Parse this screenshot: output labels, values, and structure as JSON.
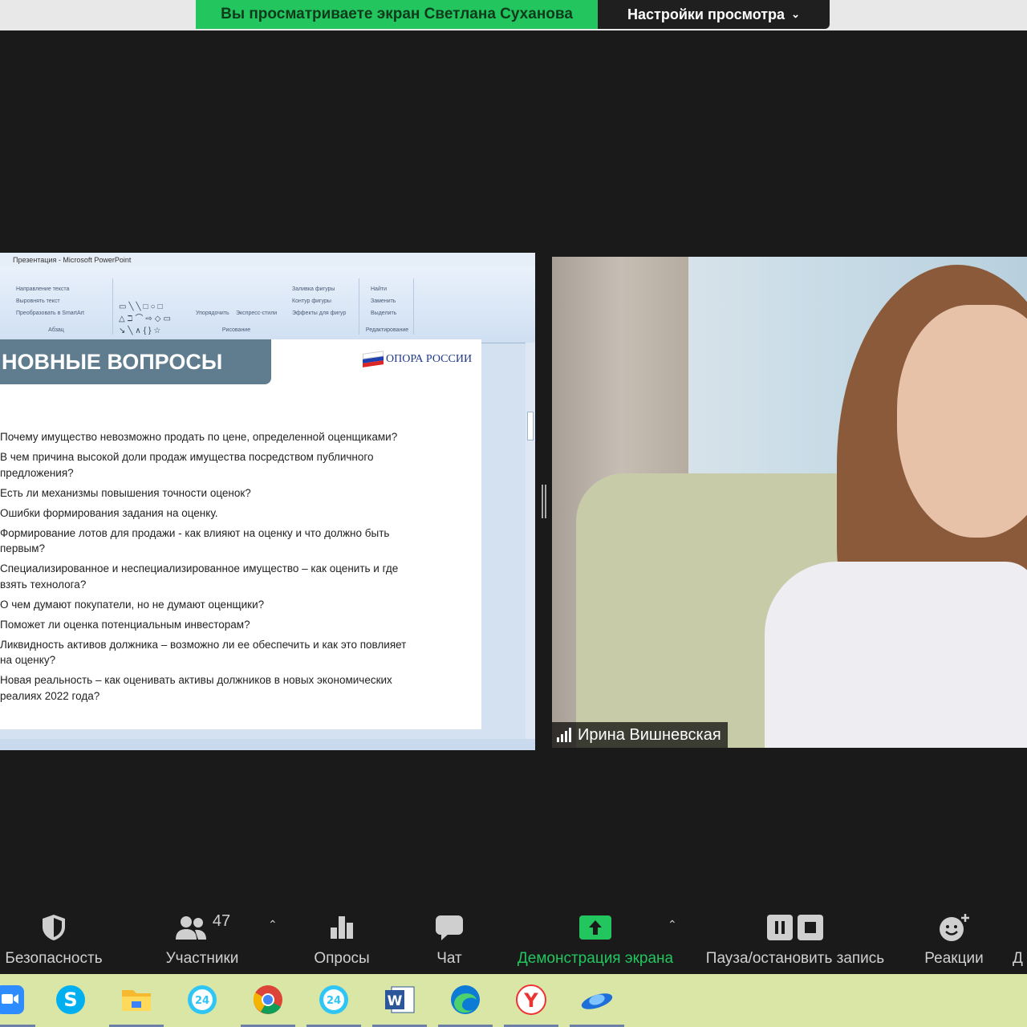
{
  "share_banner": {
    "text": "Вы просматриваете экран Светлана Суханова",
    "view_options_label": "Настройки просмотра",
    "accent": "#22c55e"
  },
  "shared_screen": {
    "window_title": "Презентация - Microsoft PowerPoint",
    "ribbon": {
      "paragraph_items": [
        "Направление текста",
        "Выровнять текст",
        "Преобразовать в SmartArt"
      ],
      "paragraph_group": "Абзац",
      "drawing_items": [
        "Упорядочить",
        "Экспресс-стили",
        "Заливка фигуры",
        "Контур фигуры",
        "Эффекты для фигур"
      ],
      "drawing_group": "Рисование",
      "editing_items": [
        "Найти",
        "Заменить",
        "Выделить"
      ],
      "editing_group": "Редактирование"
    },
    "slide": {
      "title": "НОВНЫЕ ВОПРОСЫ",
      "logo_text": "ОПОРА РОССИИ",
      "questions": [
        "Почему имущество невозможно продать по цене, определенной оценщиками?",
        "В чем причина высокой доли продаж имущества посредством публичного\nпредложения?",
        "Есть ли механизмы повышения точности оценок?",
        "Ошибки формирования задания на оценку.",
        "Формирование лотов для продажи  -  как влияют на оценку и что должно быть\nпервым?",
        "Специализированное и неспециализированное имущество – как оценить и где\nвзять технолога?",
        "О чем думают покупатели, но не думают оценщики?",
        "Поможет ли оценка потенциальным инвесторам?",
        "Ликвидность активов должника – возможно ли ее обеспечить и как это повлияет\nна оценку?",
        "Новая реальность – как оценивать активы должников в новых экономических\nреалиях 2022 года?"
      ]
    }
  },
  "participant_video": {
    "name": "Ирина Вишневская"
  },
  "toolbar": {
    "security_label": "Безопасность",
    "participants_label": "Участники",
    "participants_count": "47",
    "polls_label": "Опросы",
    "chat_label": "Чат",
    "share_screen_label": "Демонстрация экрана",
    "record_label": "Пауза/остановить запись",
    "reactions_label": "Реакции",
    "cut_label": "Д",
    "share_color": "#22c55e"
  },
  "taskbar": {
    "apps": [
      "zoom-icon",
      "skype-icon",
      "file-explorer-icon",
      "bitrix24-icon",
      "chrome-icon",
      "bitrix24-icon",
      "word-icon",
      "edge-icon",
      "yandex-browser-icon",
      "app-icon"
    ],
    "bitrix_badge": "24"
  }
}
